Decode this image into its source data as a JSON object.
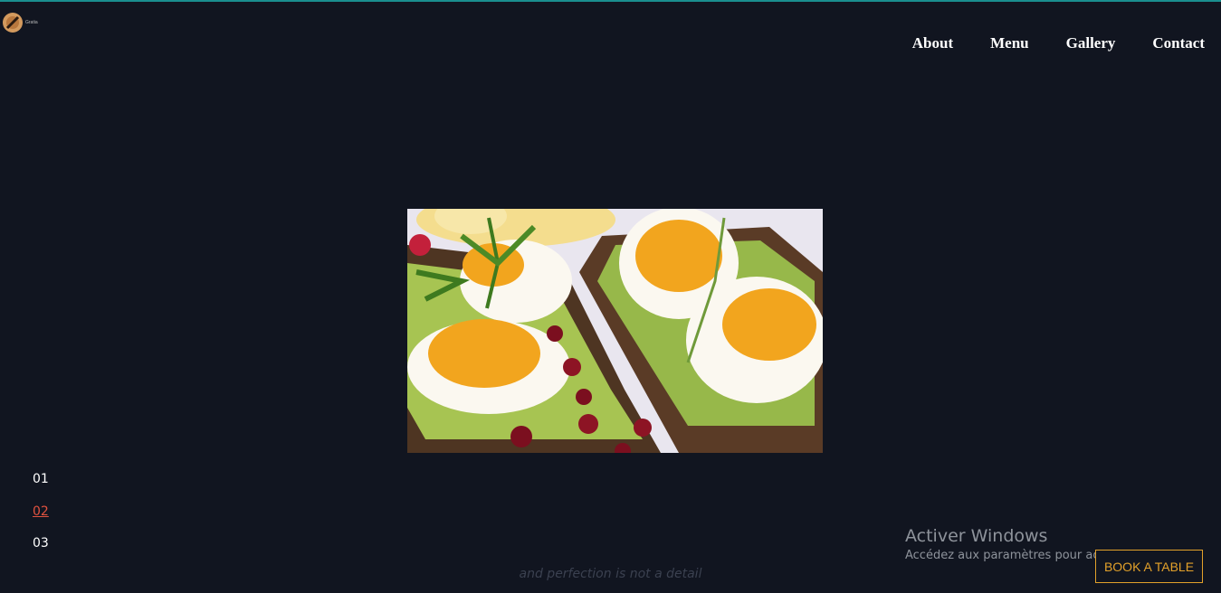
{
  "brand": {
    "logo_text": "Gratia"
  },
  "nav": {
    "items": [
      "About",
      "Menu",
      "Gallery",
      "Contact"
    ]
  },
  "hero": {
    "image": "avocado-toast-with-eggs-photo"
  },
  "slides": {
    "items": [
      "01",
      "02",
      "03"
    ],
    "active_index": 1
  },
  "tagline": "and perfection is not a detail",
  "windows_notice": {
    "title": "Activer Windows",
    "subtitle": "Accédez aux paramètres pour activer Windows."
  },
  "cta": {
    "label": "BOOK A TABLE"
  },
  "colors": {
    "background": "#111520",
    "accent": "#e3a12a",
    "active_slide": "#e0523f",
    "top_line": "#1a8f8f"
  }
}
